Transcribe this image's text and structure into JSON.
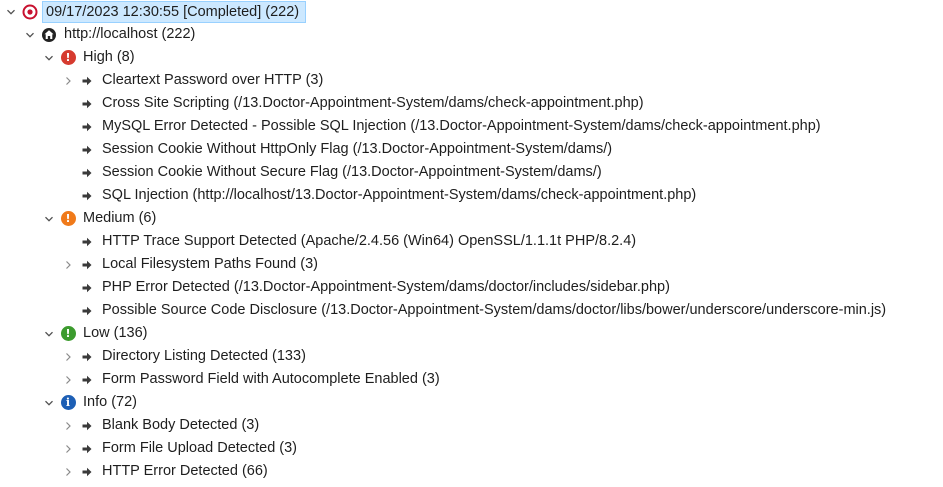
{
  "colors": {
    "selection_bg": "#cce8ff",
    "high": "#d63b2f",
    "medium": "#f07a1a",
    "low": "#3c9b2e",
    "info": "#1d5fb5",
    "target": "#c8102e"
  },
  "scan": {
    "title": "09/17/2023 12:30:55 [Completed]  (222)",
    "icon": "target-icon",
    "site": {
      "label": "http://localhost (222)",
      "icon": "site-icon",
      "groups": [
        {
          "label": "High (8)",
          "icon": "alert-high-icon",
          "items": [
            {
              "label": "Cleartext Password over HTTP (3)",
              "expandable": true
            },
            {
              "label": "Cross Site Scripting (/13.Doctor-Appointment-System/dams/check-appointment.php)",
              "expandable": false
            },
            {
              "label": "MySQL Error Detected - Possible SQL Injection (/13.Doctor-Appointment-System/dams/check-appointment.php)",
              "expandable": false
            },
            {
              "label": "Session Cookie Without HttpOnly Flag  (/13.Doctor-Appointment-System/dams/)",
              "expandable": false
            },
            {
              "label": "Session Cookie Without Secure Flag  (/13.Doctor-Appointment-System/dams/)",
              "expandable": false
            },
            {
              "label": "SQL Injection (http://localhost/13.Doctor-Appointment-System/dams/check-appointment.php)",
              "expandable": false
            }
          ]
        },
        {
          "label": "Medium (6)",
          "icon": "alert-medium-icon",
          "items": [
            {
              "label": "HTTP Trace Support Detected (Apache/2.4.56 (Win64) OpenSSL/1.1.1t PHP/8.2.4)",
              "expandable": false
            },
            {
              "label": "Local Filesystem Paths Found (3)",
              "expandable": true
            },
            {
              "label": "PHP Error Detected (/13.Doctor-Appointment-System/dams/doctor/includes/sidebar.php)",
              "expandable": false
            },
            {
              "label": "Possible Source Code Disclosure (/13.Doctor-Appointment-System/dams/doctor/libs/bower/underscore/underscore-min.js)",
              "expandable": false
            }
          ]
        },
        {
          "label": "Low (136)",
          "icon": "alert-low-icon",
          "items": [
            {
              "label": "Directory Listing Detected (133)",
              "expandable": true
            },
            {
              "label": "Form Password Field with Autocomplete Enabled (3)",
              "expandable": true
            }
          ]
        },
        {
          "label": "Info (72)",
          "icon": "info-icon",
          "items": [
            {
              "label": "Blank Body Detected (3)",
              "expandable": true
            },
            {
              "label": "Form File Upload Detected (3)",
              "expandable": true
            },
            {
              "label": "HTTP Error Detected (66)",
              "expandable": true
            }
          ]
        }
      ]
    }
  }
}
